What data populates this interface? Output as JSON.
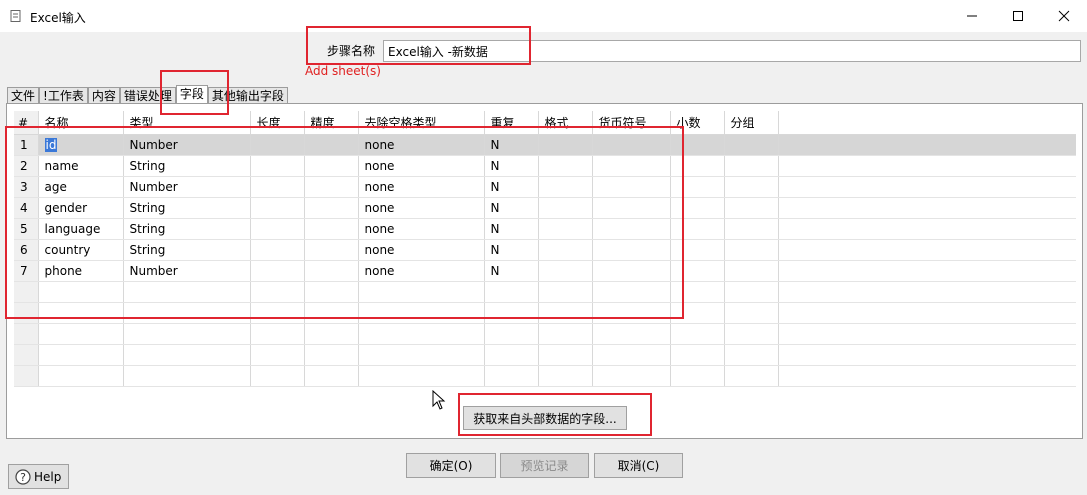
{
  "window": {
    "title": "Excel输入",
    "minimize_label": "",
    "maximize_label": "",
    "close_label": ""
  },
  "step": {
    "label": "步骤名称",
    "value": "Excel输入 -新数据"
  },
  "add_sheet": "Add sheet(s)",
  "tabs": [
    "文件",
    "!工作表",
    "内容",
    "错误处理",
    "字段",
    "其他输出字段"
  ],
  "active_tab": "字段",
  "table": {
    "columns": [
      "#",
      "名称",
      "类型",
      "长度",
      "精度",
      "去除空格类型",
      "重复",
      "格式",
      "货币符号",
      "小数",
      "分组"
    ],
    "rows": [
      [
        "1",
        "id",
        "Number",
        "",
        "",
        "none",
        "N",
        "",
        "",
        "",
        ""
      ],
      [
        "2",
        "name",
        "String",
        "",
        "",
        "none",
        "N",
        "",
        "",
        "",
        ""
      ],
      [
        "3",
        "age",
        "Number",
        "",
        "",
        "none",
        "N",
        "",
        "",
        "",
        ""
      ],
      [
        "4",
        "gender",
        "String",
        "",
        "",
        "none",
        "N",
        "",
        "",
        "",
        ""
      ],
      [
        "5",
        "language",
        "String",
        "",
        "",
        "none",
        "N",
        "",
        "",
        "",
        ""
      ],
      [
        "6",
        "country",
        "String",
        "",
        "",
        "none",
        "N",
        "",
        "",
        "",
        ""
      ],
      [
        "7",
        "phone",
        "Number",
        "",
        "",
        "none",
        "N",
        "",
        "",
        "",
        ""
      ]
    ]
  },
  "buttons": {
    "get_fields": "获取来自头部数据的字段...",
    "ok": "确定(O)",
    "preview": "预览记录",
    "cancel": "取消(C)",
    "help": "Help"
  },
  "colors": {
    "highlight_red": "#e02530",
    "add_sheet_red": "#e02020",
    "selection_blue": "#3a78d8"
  }
}
